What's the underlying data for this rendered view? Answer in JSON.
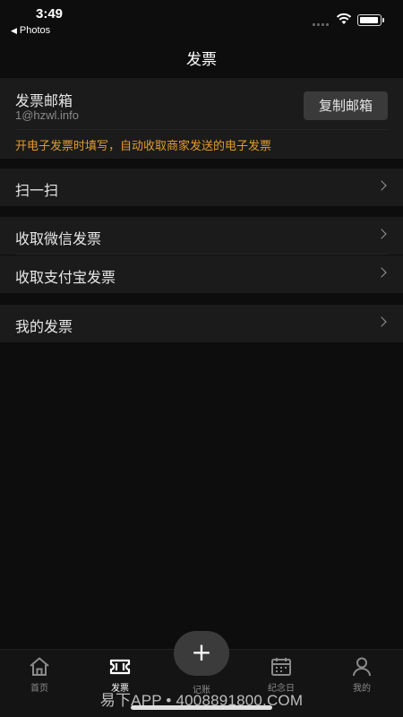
{
  "status": {
    "time": "3:49",
    "back_app": "Photos"
  },
  "nav": {
    "title": "发票"
  },
  "mail": {
    "label": "发票邮箱",
    "value": "1@hzwl.info",
    "copy_button": "复制邮箱",
    "tip": "开电子发票时填写，自动收取商家发送的电子发票"
  },
  "rows": [
    {
      "label": "扫一扫"
    },
    {
      "label": "收取微信发票"
    },
    {
      "label": "收取支付宝发票"
    },
    {
      "label": "我的发票"
    }
  ],
  "tabs": [
    {
      "label": "首页",
      "icon": "home-icon"
    },
    {
      "label": "发票",
      "icon": "ticket-icon",
      "active": true
    },
    {
      "label": "记账",
      "icon": "plus-icon"
    },
    {
      "label": "纪念日",
      "icon": "calendar-icon"
    },
    {
      "label": "我的",
      "icon": "person-icon"
    }
  ],
  "watermark": "易下APP • 4008891800.COM",
  "colors": {
    "background": "#0d0d0d",
    "card": "#1b1b1b",
    "tip_orange": "#e39b2c"
  }
}
